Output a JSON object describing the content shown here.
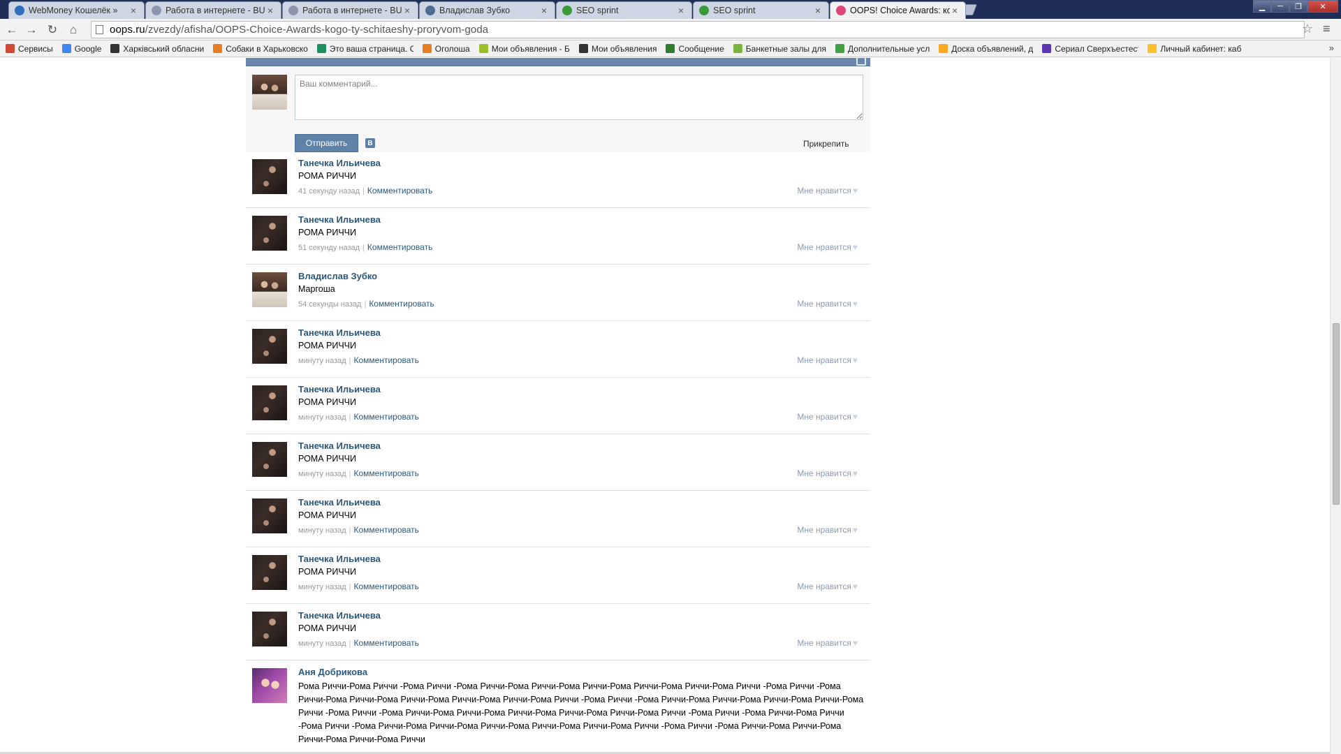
{
  "browser": {
    "tabs": [
      {
        "title": "WebMoney Кошелёк »",
        "icon": "webmoney-icon",
        "color": "#2f6dbd"
      },
      {
        "title": "Работа в интернете - BU",
        "icon": "page-icon",
        "color": "#8a96ad"
      },
      {
        "title": "Работа в интернете - BU",
        "icon": "page-icon",
        "color": "#8a96ad"
      },
      {
        "title": "Владислав Зубко",
        "icon": "vk-icon",
        "color": "#4c6c91"
      },
      {
        "title": "SEO sprint",
        "icon": "seosprint-icon",
        "color": "#3a9a3a"
      },
      {
        "title": "SEO sprint",
        "icon": "seosprint-icon",
        "color": "#3a9a3a"
      },
      {
        "title": "OOPS! Choice Awards: ко",
        "icon": "oops-icon",
        "color": "#e0457b"
      }
    ],
    "url_host": "oops.ru",
    "url_path": "/zvezdy/afisha/OOPS-Choice-Awards-kogo-ty-schitaeshy-proryvom-goda",
    "bookmarks": [
      {
        "label": "Сервисы",
        "icon": "apps-grid-icon",
        "color": "#d14836"
      },
      {
        "label": "Google",
        "icon": "google-icon",
        "color": "#4285f4"
      },
      {
        "label": "Харківський обласни",
        "icon": "coat-of-arms-icon",
        "color": "#333333"
      },
      {
        "label": "Собаки в Харьковско",
        "icon": "olx-icon",
        "color": "#e67e22"
      },
      {
        "label": "Это ваша страница. С",
        "icon": "globe-icon",
        "color": "#1f8f5f"
      },
      {
        "label": "Оголоша",
        "icon": "ad-icon",
        "color": "#e67e22"
      },
      {
        "label": "Мои объявления - Б",
        "icon": "star-figure-icon",
        "color": "#9bbf2a"
      },
      {
        "label": "Мои объявления",
        "icon": "tower-icon",
        "color": "#333333"
      },
      {
        "label": "Сообщение",
        "icon": "message-icon",
        "color": "#2e7d32"
      },
      {
        "label": "Банкетные залы для",
        "icon": "hall-icon",
        "color": "#7cb342"
      },
      {
        "label": "Дополнительные усл",
        "icon": "y-icon",
        "color": "#43a047"
      },
      {
        "label": "Доска объявлений, д",
        "icon": "coin-icon",
        "color": "#f9a825"
      },
      {
        "label": "Сериал Сверхъестест",
        "icon": "book-icon",
        "color": "#5e35b1"
      },
      {
        "label": "Личный кабинет: каб",
        "icon": "b-letter-icon",
        "color": "#fbc02d"
      }
    ],
    "more_bookmarks": "»"
  },
  "wall": {
    "comment_placeholder": "Ваш комментарий...",
    "send_label": "Отправить",
    "vk_label": "В",
    "attach_label": "Прикрепить",
    "like_label": "Мне нравится",
    "reply_label": "Комментировать",
    "comments": [
      {
        "author": "Танечка Ильичева",
        "text": "РОМА РИЧЧИ",
        "time": "41 секунду назад",
        "avatar": "dark"
      },
      {
        "author": "Танечка Ильичева",
        "text": "РОМА РИЧЧИ",
        "time": "51 секунду назад",
        "avatar": "dark"
      },
      {
        "author": "Владислав Зубко",
        "text": "Маргоша",
        "time": "54 секунды назад",
        "avatar": "couple"
      },
      {
        "author": "Танечка Ильичева",
        "text": "РОМА РИЧЧИ",
        "time": "минуту назад",
        "avatar": "dark"
      },
      {
        "author": "Танечка Ильичева",
        "text": "РОМА РИЧЧИ",
        "time": "минуту назад",
        "avatar": "dark"
      },
      {
        "author": "Танечка Ильичева",
        "text": "РОМА РИЧЧИ",
        "time": "минуту назад",
        "avatar": "dark"
      },
      {
        "author": "Танечка Ильичева",
        "text": "РОМА РИЧЧИ",
        "time": "минуту назад",
        "avatar": "dark"
      },
      {
        "author": "Танечка Ильичева",
        "text": "РОМА РИЧЧИ",
        "time": "минуту назад",
        "avatar": "dark"
      },
      {
        "author": "Танечка Ильичева",
        "text": "РОМА РИЧЧИ",
        "time": "минуту назад",
        "avatar": "dark"
      },
      {
        "author": "Аня Добрикова",
        "text": "Рома Риччи-Рома Риччи -Рома Риччи -Рома Риччи-Рома Риччи-Рома Риччи-Рома Риччи-Рома Риччи-Рома Риччи -Рома Риччи -Рома Риччи-Рома Риччи-Рома Риччи-Рома Риччи-Рома Риччи-Рома Риччи -Рома Риччи -Рома Риччи-Рома Риччи-Рома Риччи-Рома Риччи-Рома Риччи -Рома Риччи -Рома Риччи-Рома Риччи-Рома Риччи-Рома Риччи-Рома Риччи-Рома Риччи -Рома Риччи -Рома Риччи-Рома Риччи -Рома Риччи -Рома Риччи-Рома Риччи-Рома Риччи-Рома Риччи-Рома Риччи-Рома Риччи -Рома Риччи -Рома Риччи-Рома Риччи-Рома Риччи-Рома Риччи-Рома Риччи",
        "time": "",
        "avatar": "girls"
      }
    ]
  },
  "colors": {
    "link": "#2b587a",
    "button": "#5e82a8",
    "header": "#6a86ad"
  }
}
